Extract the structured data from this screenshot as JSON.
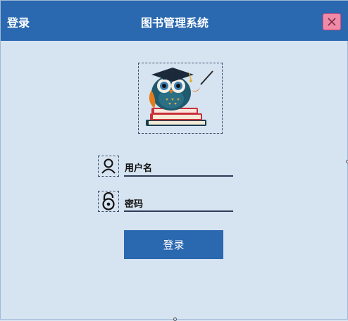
{
  "window": {
    "title_left": "登录",
    "title_center": "图书管理系统"
  },
  "icons": {
    "close": "close-icon",
    "logo": "owl-graduate-logo",
    "user": "user-icon",
    "lock": "lock-icon"
  },
  "form": {
    "username_label": "用户名",
    "username_value": "",
    "password_label": "密码",
    "password_value": ""
  },
  "actions": {
    "login_label": "登录"
  },
  "colors": {
    "titlebar": "#2a68b0",
    "background": "#d6e3f1",
    "button": "#2a68b0",
    "close_button": "#f08aa6"
  }
}
